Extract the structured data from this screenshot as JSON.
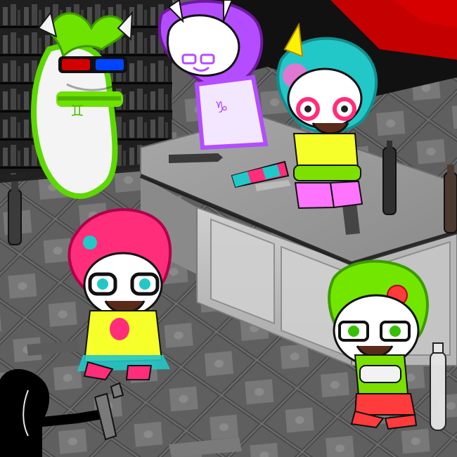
{
  "scene": {
    "kind": "illustration",
    "palette": {
      "floor": "#6e6e6e",
      "counter_top": "#8f8f8f",
      "counter_front": "#bdbdbd",
      "shelf": "#2a2a2a",
      "red_wall": "#c40000",
      "lime": "#73e600",
      "hot_pink": "#ff2d7a",
      "purple": "#b34dff",
      "teal": "#22c8c8",
      "yellow": "#f7ff2a",
      "ghost": "#f4f4f4",
      "shadow": "#000000"
    },
    "characters": [
      {
        "name": "ghost-gemini-troll",
        "colors": [
          "#6ee200",
          "#f4f4f4"
        ],
        "accessory": "red-blue-3d-glasses",
        "symbol": "gemini"
      },
      {
        "name": "purple-troll-cat-face",
        "colors": [
          "#b34dff",
          "#ffffff"
        ],
        "symbol": "capricorn"
      },
      {
        "name": "teal-haired-kid-on-counter",
        "colors": [
          "#22c8c8",
          "#f7ff2a",
          "#ff2d7a"
        ]
      },
      {
        "name": "pink-haired-kid-glasses",
        "colors": [
          "#ff2d7a",
          "#f7ff2a"
        ]
      },
      {
        "name": "green-haired-kid-with-fruit",
        "colors": [
          "#73e600",
          "#ff3b3b"
        ]
      },
      {
        "name": "shadow-figure-with-bottle",
        "colors": [
          "#000000"
        ]
      }
    ]
  }
}
